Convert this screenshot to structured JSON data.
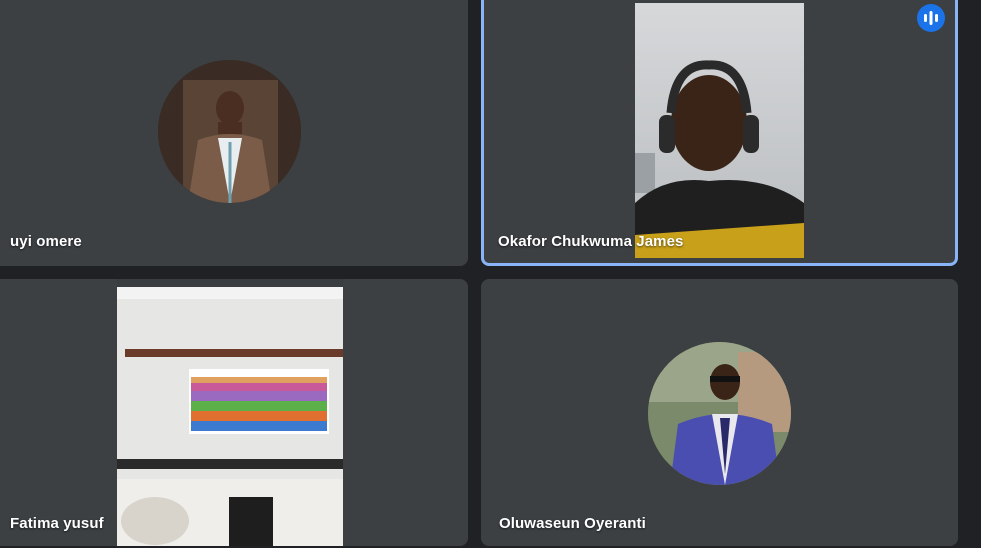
{
  "participants": [
    {
      "name": "uyi omere",
      "media": "avatar",
      "speaking": false
    },
    {
      "name": "Okafor Chukwuma James",
      "media": "camera",
      "speaking": true
    },
    {
      "name": "Fatima yusuf",
      "media": "camera",
      "speaking": false
    },
    {
      "name": "Oluwaseun Oyeranti",
      "media": "avatar",
      "speaking": false
    }
  ],
  "icons": {
    "speaking_indicator": "audio-bars-icon"
  },
  "colors": {
    "page_bg": "#202124",
    "tile_bg": "#3c4043",
    "active_border": "#8ab4f8",
    "speaking_badge": "#1a73e8"
  }
}
